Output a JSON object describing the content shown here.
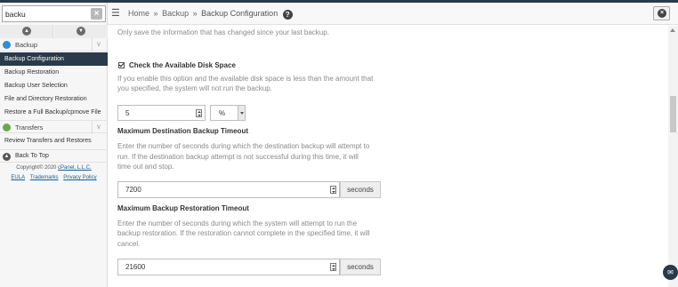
{
  "search": {
    "value": "backu",
    "clear_glyph": "×"
  },
  "sidebar": {
    "groups": [
      {
        "label": "Backup",
        "icon": "backup-icon",
        "color": "#2f8fd1"
      },
      {
        "label": "Transfers",
        "icon": "transfers-icon",
        "color": "#6aa84f"
      }
    ],
    "backup_items": [
      "Backup Configuration",
      "Backup Restoration",
      "Backup User Selection",
      "File and Directory Restoration",
      "Restore a Full Backup/cpmove File"
    ],
    "transfer_items": [
      "Review Transfers and Restores"
    ],
    "back_to_top": "Back To Top",
    "copyright_prefix": "Copyright© 2020 ",
    "copyright_link": "cPanel, L.L.C.",
    "legal": [
      "EULA",
      "Trademarks",
      "Privacy Policy"
    ]
  },
  "header": {
    "breadcrumb": [
      "Home",
      "Backup",
      "Backup Configuration"
    ],
    "separator": "»",
    "help_glyph": "?",
    "close_glyph": "×"
  },
  "main": {
    "intro_text": "Only save the information that has changed since your last backup.",
    "disk_check": {
      "label": "Check the Available Disk Space",
      "checked": true,
      "desc": [
        "If you enable this option and the available disk space is less than the amount that",
        "you specified, the system will not run the backup."
      ],
      "value": "5",
      "unit": "%"
    },
    "dest_timeout": {
      "label": "Maximum Destination Backup Timeout",
      "desc": [
        "Enter the number of seconds during which the destination backup will attempt to",
        "run. If the destination backup attempt is not successful during this time, it will",
        "time out and stop."
      ],
      "value": "7200",
      "unit": "seconds"
    },
    "restore_timeout": {
      "label": "Maximum Backup Restoration Timeout",
      "desc": [
        "Enter the number of seconds during which the system will attempt to run the",
        "backup restoration. If the restoration cannot complete in the specified time, it will",
        "cancel."
      ],
      "value": "21600",
      "unit": "seconds"
    }
  },
  "colors": {
    "nav_active_bg": "#293a4a",
    "link": "#1a5e8a"
  }
}
